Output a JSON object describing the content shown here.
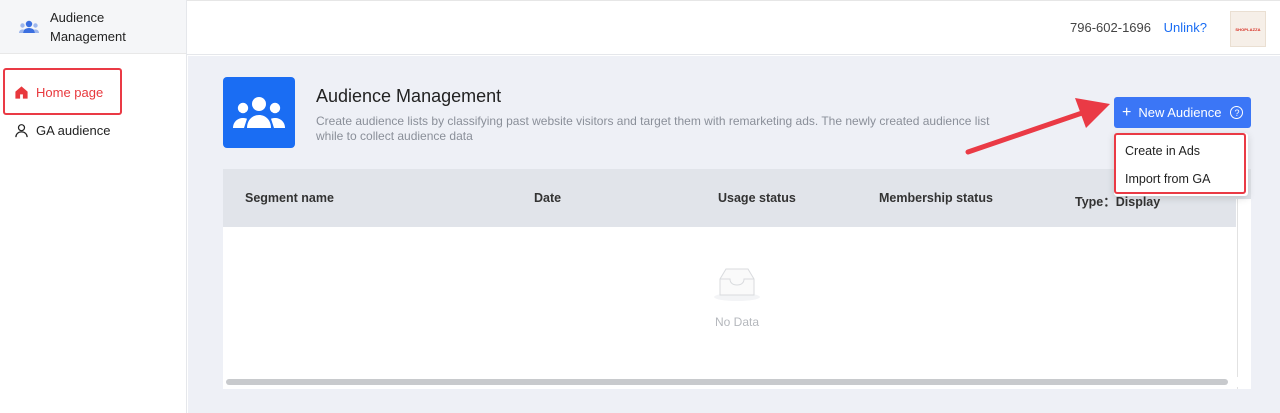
{
  "sidebar": {
    "brand_line1": "Audience",
    "brand_line2": "Management",
    "items": [
      {
        "label": "Home page",
        "icon": "home-icon",
        "active": true
      },
      {
        "label": "GA audience",
        "icon": "user-icon",
        "active": false
      }
    ]
  },
  "header": {
    "account_id": "796-602-1696",
    "unlink_label": "Unlink?",
    "avatar_text": "SHOPLAZZA"
  },
  "hero": {
    "title": "Audience Management",
    "desc_line1": "Create audience lists by classifying past website visitors and target them with remarketing ads. The newly created audience list",
    "desc_line2": "while to collect audience data"
  },
  "new_audience": {
    "label": "New Audience",
    "help": "?"
  },
  "menu": {
    "items": [
      "Create in Ads",
      "Import from GA"
    ]
  },
  "table": {
    "columns": [
      "Segment name",
      "Date",
      "Usage status",
      "Membership status",
      "Type：Display"
    ],
    "empty_text": "No Data"
  },
  "colors": {
    "accent": "#3b76f6",
    "highlight": "#ea3a45",
    "active_nav": "#e8383d",
    "main_bg": "#eef0f6"
  }
}
